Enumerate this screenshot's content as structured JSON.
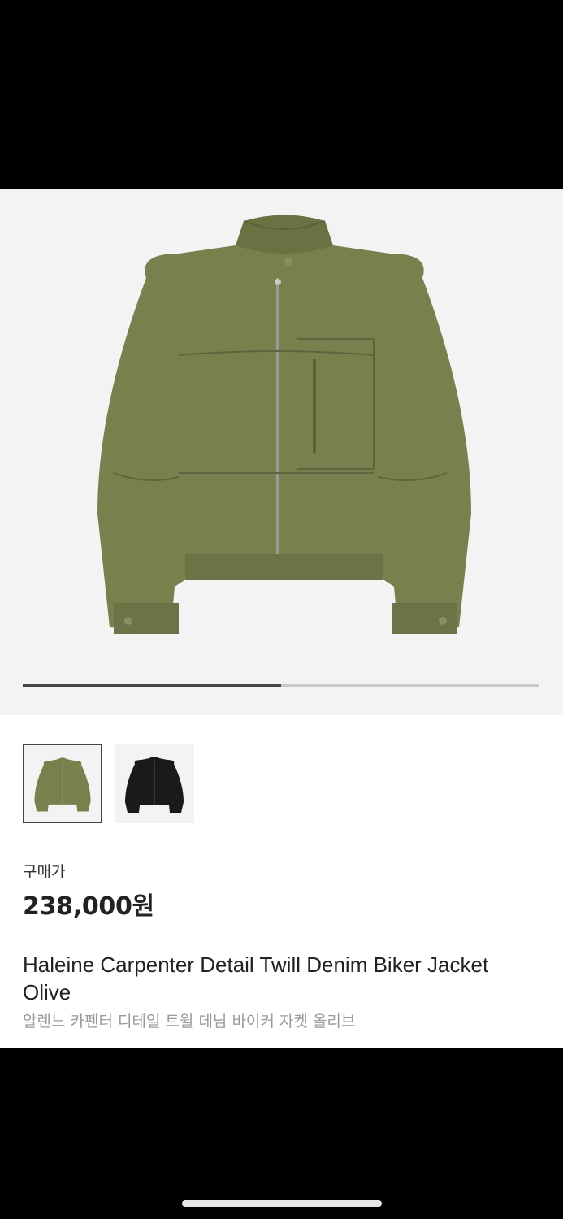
{
  "gallery": {
    "image_label": "product-photo-olive-jacket",
    "progress": 0.5,
    "track_color": "#c9c9c9",
    "fill_color": "#444444"
  },
  "thumbnails": [
    {
      "variant": "olive",
      "color": "#7a7f4e",
      "selected": true
    },
    {
      "variant": "black",
      "color": "#1a1a1a",
      "selected": false
    }
  ],
  "product": {
    "price_label": "구매가",
    "price": "238,000원",
    "name_en": "Haleine Carpenter Detail Twill Denim Biker Jacket Olive",
    "name_ko": "알렌느 카펜터 디테일 트윌 데님 바이커 자켓 올리브"
  },
  "colors": {
    "jacket_olive": "#7a7f4e",
    "jacket_olive_dark": "#666b3e",
    "hero_bg": "#f3f3f3"
  }
}
